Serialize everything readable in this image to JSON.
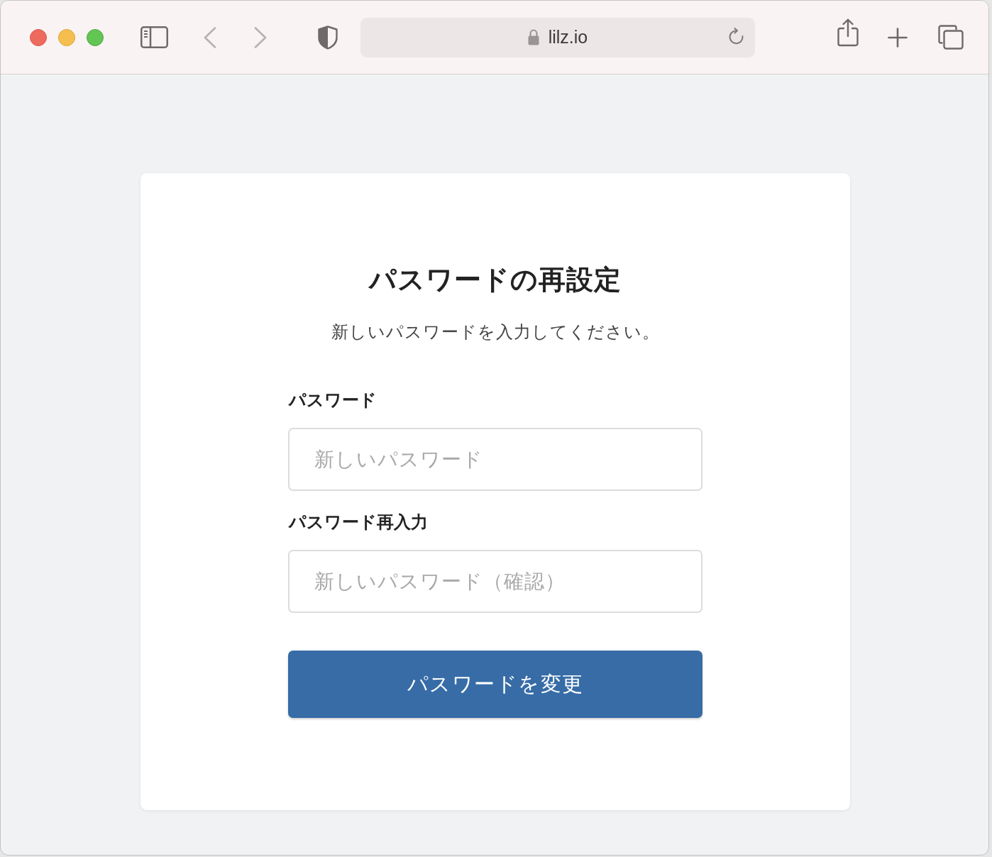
{
  "browser": {
    "back_button": {
      "disabled": true
    },
    "forward_button": {
      "disabled": true
    },
    "url": "lilz.io"
  },
  "page": {
    "title": "パスワードの再設定",
    "subtitle": "新しいパスワードを入力してください。",
    "fields": [
      {
        "label": "パスワード",
        "placeholder": "新しいパスワード"
      },
      {
        "label": "パスワード再入力",
        "placeholder": "新しいパスワード（確認）"
      }
    ],
    "submit_button": "パスワードを変更"
  }
}
